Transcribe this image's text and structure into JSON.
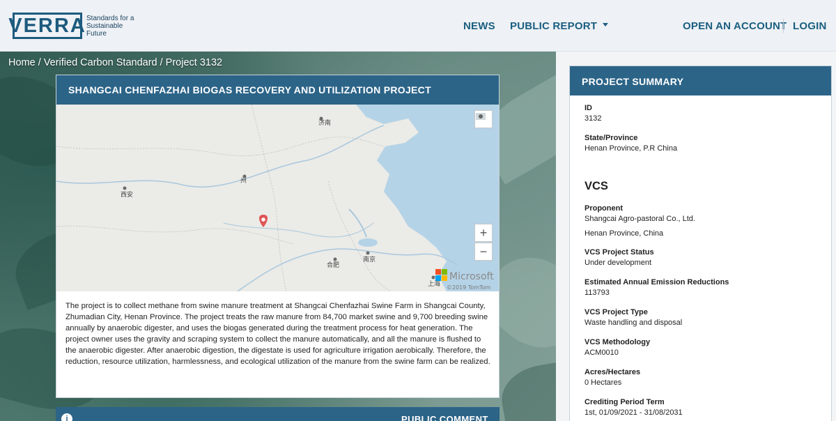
{
  "header": {
    "logo_text": "VERRA",
    "logo_tagline_1": "Standards for a",
    "logo_tagline_2": "Sustainable Future",
    "nav": {
      "news": "NEWS",
      "public_report": "PUBLIC REPORT",
      "open_account": "OPEN AN ACCOUNT",
      "login": "LOGIN"
    }
  },
  "breadcrumb": "Home / Verified Carbon Standard / Project 3132",
  "project": {
    "title": "SHANGCAI CHENFAZHAI BIOGAS RECOVERY AND UTILIZATION PROJECT",
    "map": {
      "labels": [
        "济南",
        "州",
        "西安",
        "合肥",
        "南京",
        "上海"
      ],
      "attribution": "©2019 TomTom",
      "provider": "Microsoft",
      "zoom_in": "+",
      "zoom_out": "−"
    },
    "description": "The project is to collect methane from swine manure treatment at Shangcai Chenfazhai Swine Farm in Shangcai County, Zhumadian City, Henan Province. The project treats the raw manure from 84,700 market swine and 9,700 breeding swine annually by anaerobic digester, and uses the biogas generated during the treatment process for heat generation. The project owner uses the gravity and scraping system to collect the manure automatically, and all the manure is flushed to the anaerobic digester. After anaerobic digestion, the digestate is used for agriculture irrigation aerobically. Therefore, the reduction, resource utilization, harmlessness, and ecological utilization of the manure from the swine farm can be realized."
  },
  "public_comment": {
    "label": "PUBLIC COMMENT"
  },
  "summary": {
    "title": "PROJECT SUMMARY",
    "id_label": "ID",
    "id_value": "3132",
    "state_label": "State/Province",
    "state_value": "Henan Province, P.R China",
    "vcs_title": "VCS",
    "proponent_label": "Proponent",
    "proponent_value_1": "Shangcai Agro-pastoral Co., Ltd.",
    "proponent_value_2": "Henan Province, China",
    "status_label": "VCS Project Status",
    "status_value": "Under development",
    "ear_label": "Estimated Annual Emission Reductions",
    "ear_value": "113793",
    "type_label": "VCS Project Type",
    "type_value": "Waste handling and disposal",
    "method_label": "VCS Methodology",
    "method_value": "ACM0010",
    "acres_label": "Acres/Hectares",
    "acres_value": "0 Hectares",
    "crediting_label": "Crediting Period Term",
    "crediting_value": "1st, 01/09/2021 - 31/08/2031"
  }
}
